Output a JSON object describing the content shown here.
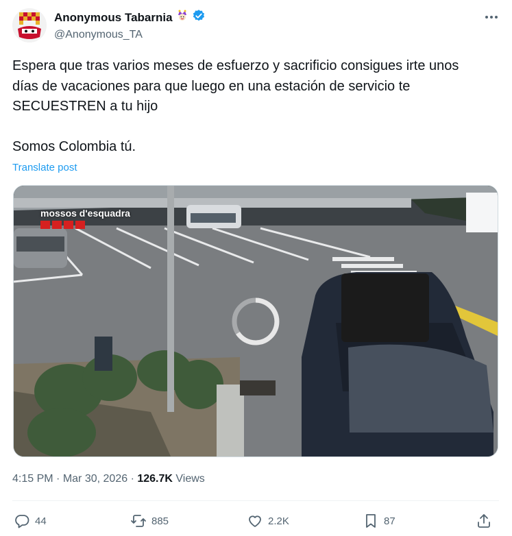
{
  "author": {
    "display_name": "Anonymous Tabarnia",
    "handle": "@Anonymous_TA",
    "verified": true,
    "verified_color": "#1d9bf0"
  },
  "menu": {
    "more_icon": "more-horizontal-icon"
  },
  "tweet": {
    "lines": [
      "Espera que tras varios meses de esfuerzo y sacrificio consigues irte unos",
      "días de vacaciones para que luego en una estación de servicio te",
      "SECUESTREN a tu hijo"
    ],
    "second_paragraph": "Somos Colombia tú.",
    "translate_label": "Translate post"
  },
  "media": {
    "watermark": "mossos d'esquadra",
    "state": "loading"
  },
  "meta": {
    "time": "4:15 PM",
    "separator": "·",
    "date": "Mar 30, 2026",
    "views_count": "126.7K",
    "views_label": "Views"
  },
  "actions": {
    "replies": "44",
    "reposts": "885",
    "likes": "2.2K",
    "bookmarks": "87"
  },
  "colors": {
    "text": "#0f1419",
    "secondary": "#536471",
    "link": "#1d9bf0"
  }
}
